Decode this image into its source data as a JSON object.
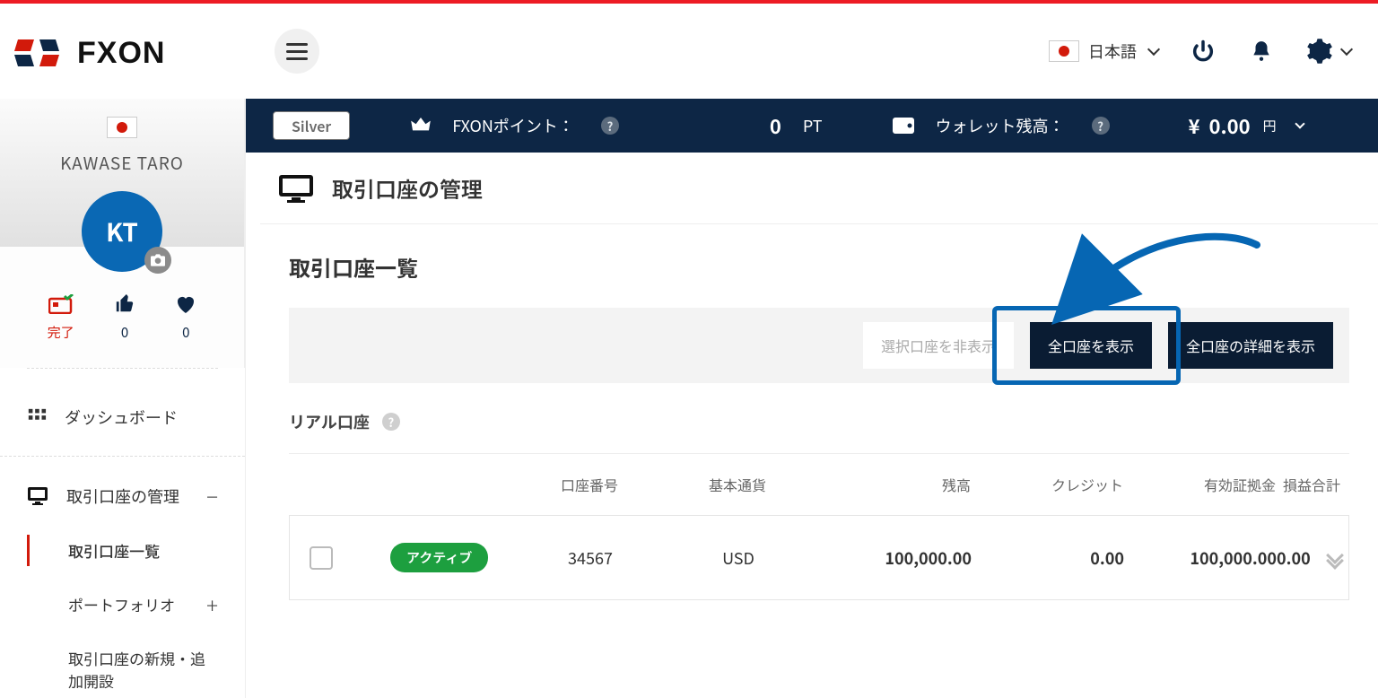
{
  "header": {
    "brand": "FXON",
    "language_label": "日本語"
  },
  "profile": {
    "name": "KAWASE TARO",
    "initials": "KT",
    "stat1_label": "完了",
    "stat2_value": "0",
    "stat3_value": "0"
  },
  "sidebar": {
    "dashboard": "ダッシュボード",
    "manage_accounts": "取引口座の管理",
    "sub": {
      "account_list": "取引口座一覧",
      "portfolio": "ポートフォリオ",
      "open_new": "取引口座の新規・追加開設"
    }
  },
  "infobar": {
    "tier": "Silver",
    "points_label": "FXONポイント：",
    "points_value": "0",
    "points_unit": "PT",
    "wallet_label": "ウォレット残高：",
    "wallet_currency": "¥",
    "wallet_amount": "0.00",
    "wallet_unit": "円"
  },
  "page": {
    "heading": "取引口座の管理",
    "card_title": "取引口座一覧",
    "toolbar": {
      "hide_selected": "選択口座を非表示",
      "show_all": "全口座を表示",
      "show_all_details": "全口座の詳細を表示"
    },
    "section_real": "リアル口座",
    "columns": {
      "account_no": "口座番号",
      "base_ccy": "基本通貨",
      "balance": "残高",
      "credit": "クレジット",
      "equity": "有効証拠金",
      "pl": "損益合計"
    },
    "row": {
      "status": "アクティブ",
      "account_no": "34567",
      "base_ccy": "USD",
      "balance": "100,000.00",
      "credit": "0.00",
      "equity": "100,000.00",
      "pl": "0.00"
    }
  }
}
